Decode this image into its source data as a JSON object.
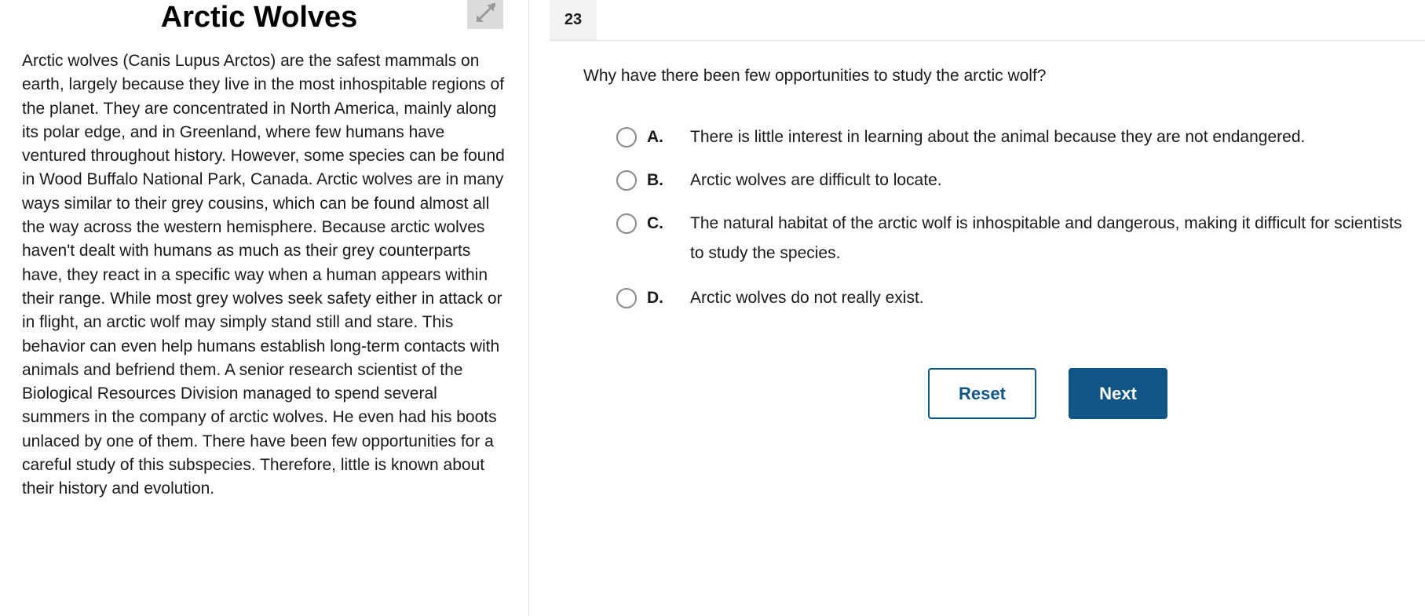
{
  "passage": {
    "title": "Arctic Wolves",
    "expand_icon": "expand-arrows-icon",
    "text": "Arctic wolves (Canis Lupus Arctos) are the safest mammals on earth, largely because they live in the most inhospitable regions of the planet. They are concentrated in North America, mainly along its polar edge, and in Greenland, where few humans have ventured throughout history. However, some species can be found in Wood Buffalo National Park, Canada. Arctic wolves are in many ways similar to their grey cousins, which can be found almost all the way across the western hemisphere. Because arctic wolves haven't dealt with humans as much as their grey counterparts have, they react in a specific way when a human appears within their range. While most grey wolves seek safety either in attack or in flight, an arctic wolf may simply stand still and stare. This behavior can even help humans establish long-term contacts with animals and befriend them. A senior research scientist of the Biological Resources Division managed to spend several summers in the company of arctic wolves. He even had his boots unlaced by one of them. There have been few opportunities for a careful study of this subspecies. Therefore, little is known about their history and evolution."
  },
  "question": {
    "number": "23",
    "prompt": "Why have there been few opportunities to study the arctic wolf?",
    "options": [
      {
        "letter": "A.",
        "text": "There is little interest in learning about the animal because they are not endangered."
      },
      {
        "letter": "B.",
        "text": "Arctic wolves are difficult to locate."
      },
      {
        "letter": "C.",
        "text": "The natural habitat of the arctic wolf is inhospitable and dangerous, making it difficult for scientists to study the species."
      },
      {
        "letter": "D.",
        "text": "Arctic wolves do not really exist."
      }
    ]
  },
  "buttons": {
    "reset_label": "Reset",
    "next_label": "Next"
  },
  "colors": {
    "accent": "#0f5585",
    "radio_border": "#8a8a8a",
    "number_badge_bg": "#f2f2f2",
    "expand_button_bg": "#dcdcdc"
  }
}
